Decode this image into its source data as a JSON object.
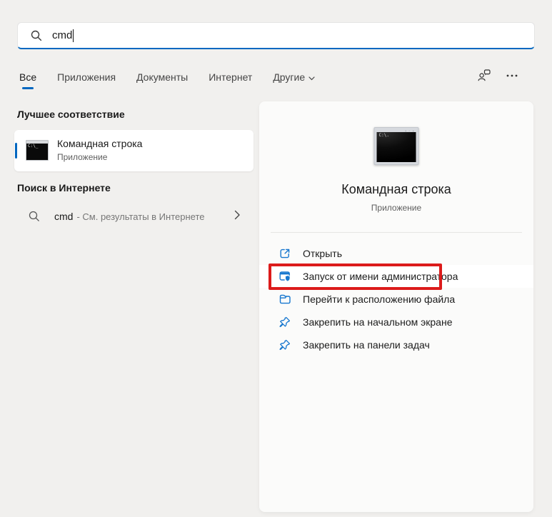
{
  "search": {
    "value": "cmd",
    "icon": "search-icon"
  },
  "tabs": {
    "items": [
      {
        "label": "Все",
        "active": true
      },
      {
        "label": "Приложения",
        "active": false
      },
      {
        "label": "Документы",
        "active": false
      },
      {
        "label": "Интернет",
        "active": false
      },
      {
        "label": "Другие",
        "active": false,
        "has_dropdown": true
      }
    ]
  },
  "header_icons": [
    {
      "name": "feedback-account-icon"
    },
    {
      "name": "more-options-icon"
    }
  ],
  "left": {
    "best_match_heading": "Лучшее соответствие",
    "best_match": {
      "title": "Командная строка",
      "subtitle": "Приложение",
      "icon": "cmd-terminal-icon",
      "selected_accent_color": "#0067c0"
    },
    "web_heading": "Поиск в Интернете",
    "web_row": {
      "query": "cmd",
      "rest": "- См. результаты в Интернете",
      "icon": "search-icon",
      "chevron": "chevron-right-icon"
    }
  },
  "preview": {
    "icon": "cmd-terminal-icon-large",
    "icon_prompt": "C:\\.",
    "icon_prompt_small": "C:\\_",
    "title": "Командная строка",
    "subtitle": "Приложение",
    "actions": [
      {
        "label": "Открыть",
        "icon": "open-icon",
        "highlighted": false
      },
      {
        "label": "Запуск от имени администратора",
        "icon": "admin-shield-icon",
        "highlighted": true
      },
      {
        "label": "Перейти к расположению файла",
        "icon": "folder-icon",
        "highlighted": false
      },
      {
        "label": "Закрепить на начальном экране",
        "icon": "pin-icon",
        "highlighted": false
      },
      {
        "label": "Закрепить на панели задач",
        "icon": "pin-icon",
        "highlighted": false
      }
    ]
  },
  "colors": {
    "accent": "#0067c0",
    "action_icon_blue": "#1777cf",
    "highlight_red": "#dc1b1b",
    "background": "#f1f0ee",
    "panel": "#fbfbfa"
  }
}
